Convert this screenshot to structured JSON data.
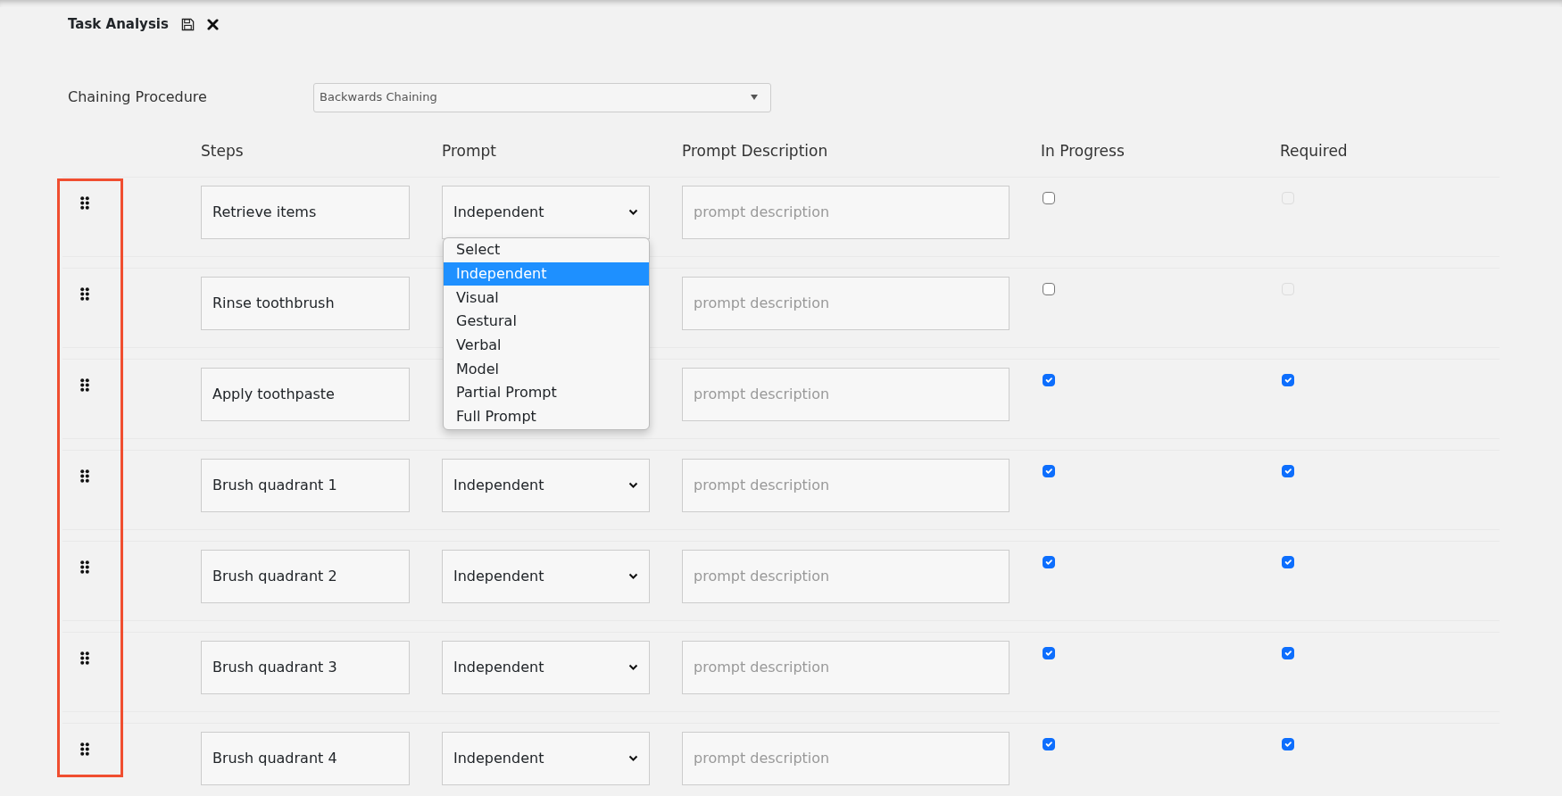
{
  "header": {
    "title": "Task Analysis"
  },
  "chaining": {
    "label": "Chaining Procedure",
    "value": "Backwards Chaining"
  },
  "columns": [
    "Steps",
    "Prompt",
    "Prompt Description",
    "In Progress",
    "Required"
  ],
  "drag_column_highlighted": true,
  "steps": [
    {
      "name": "Retrieve items",
      "prompt": "Independent",
      "placeholder": "prompt description",
      "in_progress": {
        "checked": false,
        "disabled": false
      },
      "required": {
        "checked": false,
        "disabled": true
      }
    },
    {
      "name": "Rinse toothbrush",
      "placeholder": "prompt description",
      "in_progress": {
        "checked": false,
        "disabled": false
      },
      "required": {
        "checked": false,
        "disabled": true
      }
    },
    {
      "name": "Apply toothpaste",
      "placeholder": "prompt description",
      "in_progress": {
        "checked": true,
        "disabled": false
      },
      "required": {
        "checked": true,
        "disabled": false
      }
    },
    {
      "name": "Brush quadrant 1",
      "prompt": "Independent",
      "placeholder": "prompt description",
      "in_progress": {
        "checked": true,
        "disabled": false
      },
      "required": {
        "checked": true,
        "disabled": false
      }
    },
    {
      "name": "Brush quadrant 2",
      "prompt": "Independent",
      "placeholder": "prompt description",
      "in_progress": {
        "checked": true,
        "disabled": false
      },
      "required": {
        "checked": true,
        "disabled": false
      }
    },
    {
      "name": "Brush quadrant 3",
      "prompt": "Independent",
      "placeholder": "prompt description",
      "in_progress": {
        "checked": true,
        "disabled": false
      },
      "required": {
        "checked": true,
        "disabled": false
      }
    },
    {
      "name": "Brush quadrant 4",
      "prompt": "Independent",
      "placeholder": "prompt description",
      "in_progress": {
        "checked": true,
        "disabled": false
      },
      "required": {
        "checked": true,
        "disabled": false
      }
    }
  ],
  "prompt_menu": {
    "options": [
      {
        "label": "Select",
        "selected": false
      },
      {
        "label": "Independent",
        "selected": true
      },
      {
        "label": "Visual",
        "selected": false
      },
      {
        "label": "Gestural",
        "selected": false
      },
      {
        "label": "Verbal",
        "selected": false
      },
      {
        "label": "Model",
        "selected": false
      },
      {
        "label": "Partial Prompt",
        "selected": false
      },
      {
        "label": "Full Prompt",
        "selected": false
      }
    ]
  }
}
